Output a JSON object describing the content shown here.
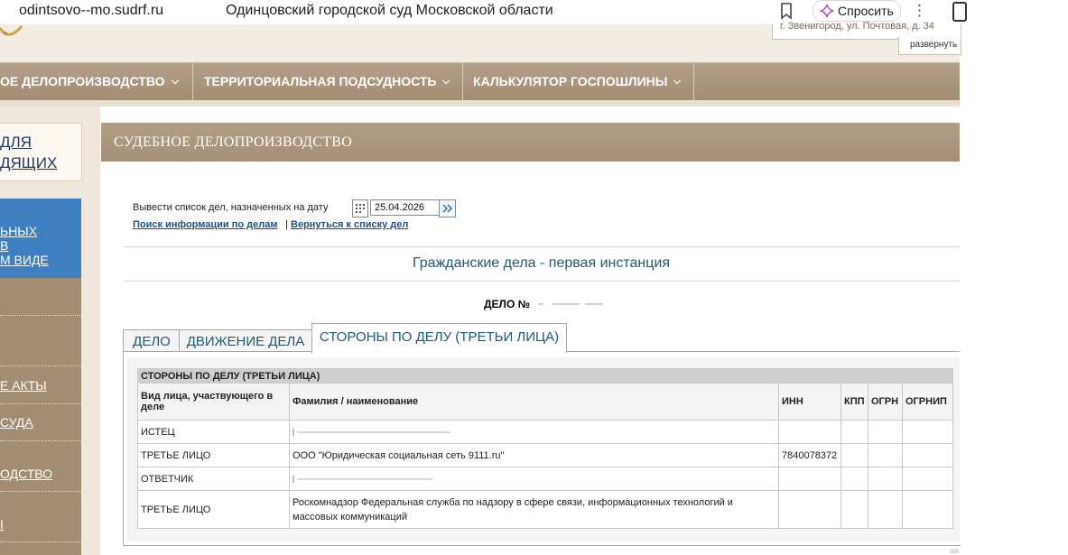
{
  "browser": {
    "url": "odintsovo--mo.sudrf.ru",
    "page_title": "Одинцовский городской суд Московской области",
    "ask_label": "Спросить"
  },
  "header": {
    "address_fragment": "г. Звенигород, ул. Почтовая, д. 34",
    "expand_label": "развернуть"
  },
  "nav": {
    "items": [
      "ОЕ ДЕЛОПРОИЗВОДСТВО",
      "ТЕРРИТОРИАЛЬНАЯ ПОДСУДНОСТЬ",
      "КАЛЬКУЛЯТОР ГОСПОШЛИНЫ"
    ]
  },
  "sidebar": {
    "box_lines": [
      "ДЛЯ",
      "ДЯЩИХ"
    ],
    "blue_lines": [
      "ЬНЫХ",
      "В",
      "М ВИДЕ"
    ],
    "menu_items": [
      "Е АКТЫ",
      "СУДА",
      "ОДСТВО",
      "I"
    ]
  },
  "main": {
    "section_title": "СУДЕБНОЕ ДЕЛОПРОИЗВОДСТВО",
    "date_label": "Вывести список дел, назначенных на дату",
    "date_value": "25.04.2026",
    "link_search": "Поиск информации по делам",
    "link_separator": "|",
    "link_back": "Вернуться к списку дел",
    "instance_title": "Гражданские дела - первая инстанция",
    "case_label": "ДЕЛО №"
  },
  "tabs": [
    {
      "label": "ДЕЛО",
      "active": false
    },
    {
      "label": "ДВИЖЕНИЕ ДЕЛА",
      "active": false
    },
    {
      "label": "СТОРОНЫ ПО ДЕЛУ (ТРЕТЬИ ЛИЦА)",
      "active": true
    }
  ],
  "parties_table": {
    "caption": "СТОРОНЫ ПО ДЕЛУ (ТРЕТЬИ ЛИЦА)",
    "columns": [
      "Вид лица, участвующего в деле",
      "Фамилия / наименование",
      "ИНН",
      "КПП",
      "ОГРН",
      "ОГРНИП"
    ],
    "rows": [
      {
        "role": "ИСТЕЦ",
        "name": "",
        "inn": "",
        "kpp": "",
        "ogrn": "",
        "ogrnip": ""
      },
      {
        "role": "ТРЕТЬЕ ЛИЦО",
        "name": "ООО \"Юридическая социальная сеть 9111.ru\"",
        "inn": "7840078372",
        "kpp": "",
        "ogrn": "",
        "ogrnip": ""
      },
      {
        "role": "ОТВЕТЧИК",
        "name": "",
        "inn": "",
        "kpp": "",
        "ogrn": "",
        "ogrnip": ""
      },
      {
        "role": "ТРЕТЬЕ ЛИЦО",
        "name": "Роскомнадзор Федеральная служба по надзору в сфере связи, информационных технологий и массовых коммуникаций",
        "inn": "",
        "kpp": "",
        "ogrn": "",
        "ogrnip": ""
      }
    ]
  },
  "colors": {
    "nav_brown": "#a28c73",
    "header_beige": "#f2ebe2",
    "side_blue": "#3d7fc1",
    "link_blue": "#1f4f80",
    "title_teal": "#1e5a72"
  }
}
